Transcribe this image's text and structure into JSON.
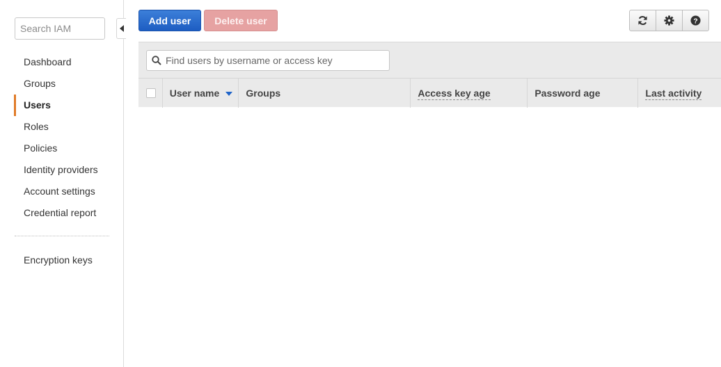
{
  "sidebar": {
    "search_placeholder": "Search IAM",
    "items": [
      {
        "label": "Dashboard"
      },
      {
        "label": "Groups"
      },
      {
        "label": "Users"
      },
      {
        "label": "Roles"
      },
      {
        "label": "Policies"
      },
      {
        "label": "Identity providers"
      },
      {
        "label": "Account settings"
      },
      {
        "label": "Credential report"
      }
    ],
    "secondary_items": [
      {
        "label": "Encryption keys"
      }
    ],
    "active_item": "Users",
    "active_color": "#e07b28"
  },
  "toolbar": {
    "add_user_label": "Add user",
    "delete_user_label": "Delete user",
    "icons": [
      "refresh-icon",
      "gear-icon",
      "help-icon"
    ]
  },
  "table": {
    "filter_placeholder": "Find users by username or access key",
    "columns": [
      {
        "label": "User name",
        "sorted": "descending"
      },
      {
        "label": "Groups"
      },
      {
        "label": "Access key age"
      },
      {
        "label": "Password age"
      },
      {
        "label": "Last activity"
      }
    ]
  },
  "colors": {
    "primary": "#1d5dc2",
    "danger_disabled": "#e6a2a2"
  }
}
